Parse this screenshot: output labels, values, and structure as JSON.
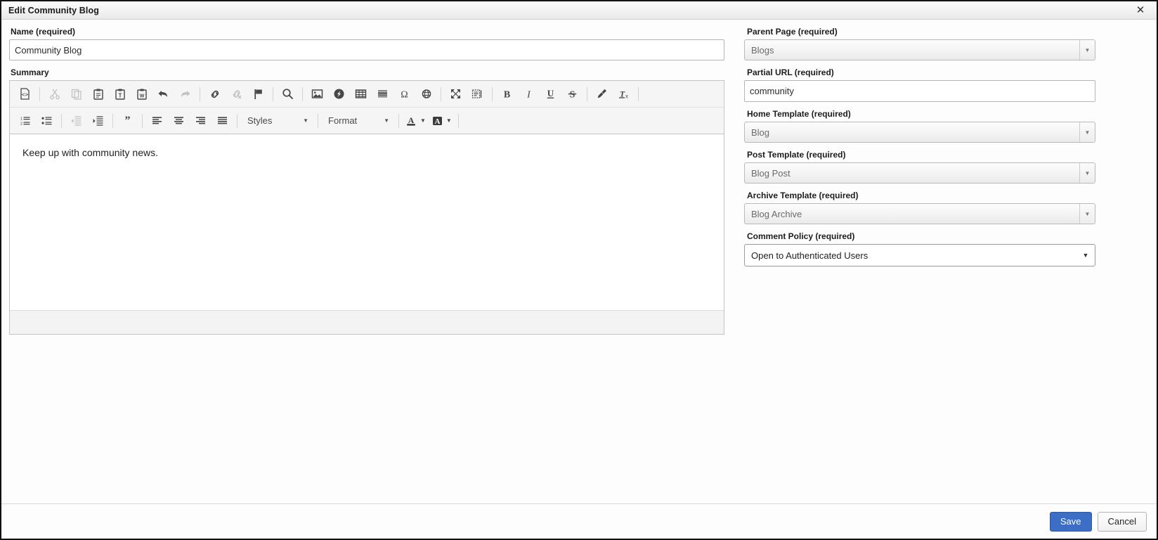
{
  "window": {
    "title": "Edit Community Blog",
    "close_label": "✕"
  },
  "left": {
    "name": {
      "label": "Name (required)",
      "value": "Community Blog",
      "placeholder": "Name"
    },
    "summary": {
      "label": "Summary",
      "content": "Keep up with community news.",
      "toolbar_row1": [
        {
          "name": "source-icon",
          "title": "Source"
        },
        {
          "name": "cut-icon",
          "title": "Cut",
          "disabled": true
        },
        {
          "name": "copy-icon",
          "title": "Copy",
          "disabled": true
        },
        {
          "name": "paste-icon",
          "title": "Paste"
        },
        {
          "name": "paste-as-text-icon",
          "title": "Paste as plain text"
        },
        {
          "name": "paste-from-word-icon",
          "title": "Paste from Word"
        },
        {
          "name": "undo-icon",
          "title": "Undo"
        },
        {
          "name": "redo-icon",
          "title": "Redo",
          "disabled": true
        },
        {
          "name": "link-icon",
          "title": "Link"
        },
        {
          "name": "unlink-icon",
          "title": "Unlink",
          "disabled": true
        },
        {
          "name": "anchor-flag-icon",
          "title": "Anchor"
        },
        {
          "name": "find-icon",
          "title": "Find"
        },
        {
          "name": "image-icon",
          "title": "Image"
        },
        {
          "name": "flash-icon",
          "title": "Flash"
        },
        {
          "name": "table-icon",
          "title": "Table"
        },
        {
          "name": "horizontal-rule-icon",
          "title": "Horizontal Line"
        },
        {
          "name": "special-character-icon",
          "title": "Insert Special Character"
        },
        {
          "name": "iframe-globe-icon",
          "title": "IFrame"
        },
        {
          "name": "maximize-icon",
          "title": "Maximize"
        },
        {
          "name": "show-blocks-icon",
          "title": "Show Blocks"
        },
        {
          "name": "bold-icon",
          "title": "Bold"
        },
        {
          "name": "italic-icon",
          "title": "Italic"
        },
        {
          "name": "underline-icon",
          "title": "Underline"
        },
        {
          "name": "strikethrough-icon",
          "title": "Strikethrough"
        },
        {
          "name": "copy-formatting-brush-icon",
          "title": "Copy Formatting"
        },
        {
          "name": "remove-format-icon",
          "title": "Remove Format"
        }
      ],
      "toolbar_row2": [
        {
          "name": "numbered-list-icon",
          "title": "Insert/Remove Numbered List"
        },
        {
          "name": "bulleted-list-icon",
          "title": "Insert/Remove Bulleted List"
        },
        {
          "name": "decrease-indent-icon",
          "title": "Decrease Indent",
          "disabled": true
        },
        {
          "name": "increase-indent-icon",
          "title": "Increase Indent"
        },
        {
          "name": "blockquote-icon",
          "title": "Block Quote"
        },
        {
          "name": "align-left-icon",
          "title": "Align Left"
        },
        {
          "name": "align-center-icon",
          "title": "Center"
        },
        {
          "name": "align-right-icon",
          "title": "Align Right"
        },
        {
          "name": "justify-icon",
          "title": "Justify"
        }
      ],
      "styles_dropdown": "Styles",
      "format_dropdown": "Format",
      "text_color_label": "A",
      "bg_color_label": "A"
    }
  },
  "right": {
    "parent_page": {
      "label": "Parent Page (required)",
      "value": "Blogs",
      "disabled": true
    },
    "partial_url": {
      "label": "Partial URL (required)",
      "value": "community",
      "placeholder": "Partial URL"
    },
    "home_template": {
      "label": "Home Template (required)",
      "value": "Blog",
      "disabled": true
    },
    "post_template": {
      "label": "Post Template (required)",
      "value": "Blog Post",
      "disabled": true
    },
    "archive_template": {
      "label": "Archive Template (required)",
      "value": "Blog Archive",
      "disabled": true
    },
    "comment_policy": {
      "label": "Comment Policy (required)",
      "value": "Open to Authenticated Users",
      "disabled": false
    }
  },
  "footer": {
    "save_label": "Save",
    "cancel_label": "Cancel"
  },
  "colors": {
    "primary_button": "#3b6ec4",
    "title_text": "#1a1a1a",
    "toolbar_bg": "#f5f5f5"
  }
}
